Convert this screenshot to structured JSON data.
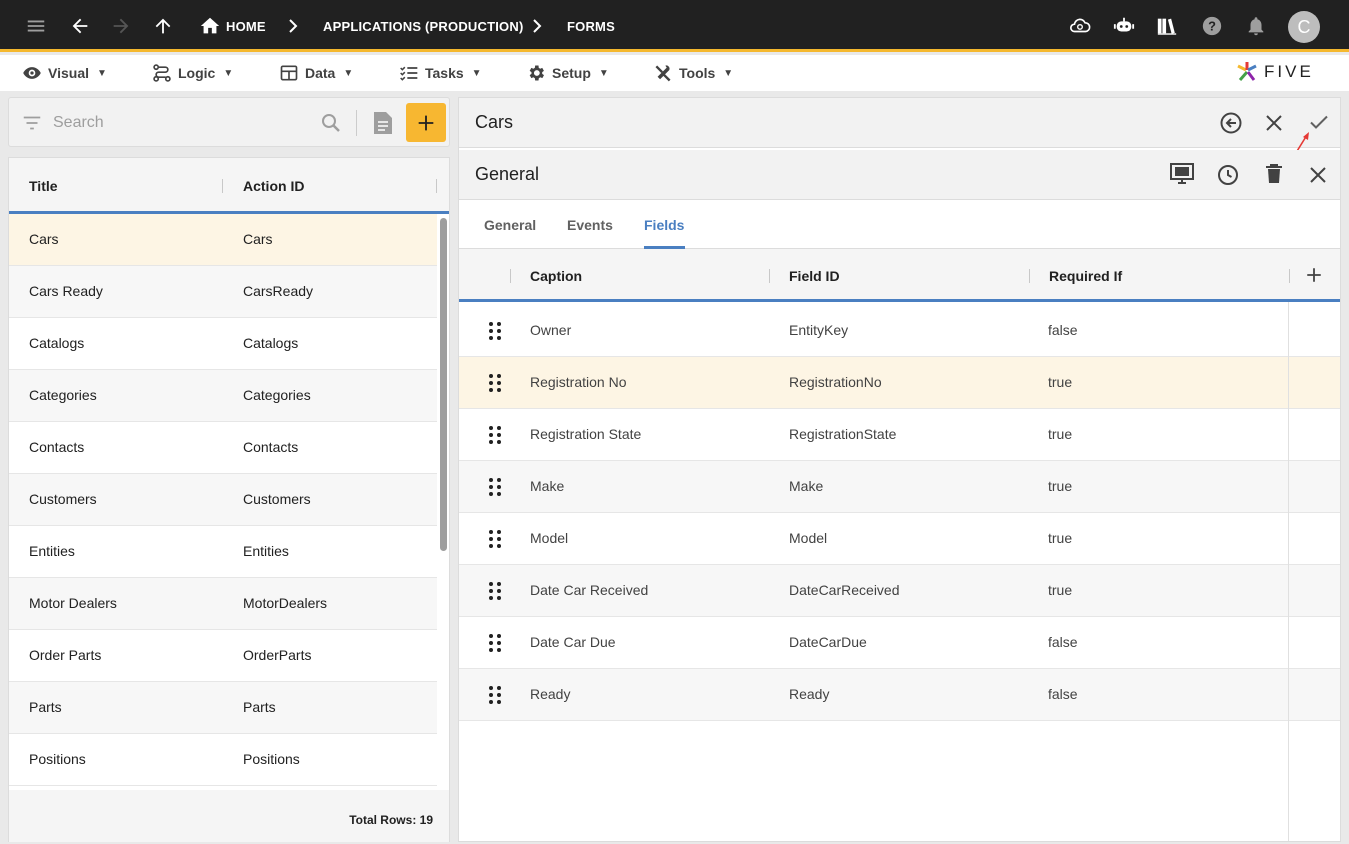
{
  "breadcrumbs": [
    "HOME",
    "APPLICATIONS (PRODUCTION)",
    "FORMS"
  ],
  "user_initial": "C",
  "menu": [
    {
      "label": "Visual",
      "icon": "eye-icon"
    },
    {
      "label": "Logic",
      "icon": "logic-icon"
    },
    {
      "label": "Data",
      "icon": "table-icon"
    },
    {
      "label": "Tasks",
      "icon": "tasks-icon"
    },
    {
      "label": "Setup",
      "icon": "gear-icon"
    },
    {
      "label": "Tools",
      "icon": "tools-icon"
    }
  ],
  "logo_text": "FIVE",
  "search": {
    "placeholder": "Search"
  },
  "left_table": {
    "columns": [
      "Title",
      "Action ID"
    ],
    "rows": [
      [
        "Cars",
        "Cars"
      ],
      [
        "Cars Ready",
        "CarsReady"
      ],
      [
        "Catalogs",
        "Catalogs"
      ],
      [
        "Categories",
        "Categories"
      ],
      [
        "Contacts",
        "Contacts"
      ],
      [
        "Customers",
        "Customers"
      ],
      [
        "Entities",
        "Entities"
      ],
      [
        "Motor Dealers",
        "MotorDealers"
      ],
      [
        "Order Parts",
        "OrderParts"
      ],
      [
        "Parts",
        "Parts"
      ],
      [
        "Positions",
        "Positions"
      ]
    ],
    "total_rows": "Total Rows: 19"
  },
  "form": {
    "title": "Cars",
    "section_title": "General",
    "tabs": [
      "General",
      "Events",
      "Fields"
    ],
    "active_tab": "Fields",
    "fields_columns": [
      "Caption",
      "Field ID",
      "Required If"
    ],
    "fields_rows": [
      [
        "Owner",
        "EntityKey",
        "false"
      ],
      [
        "Registration No",
        "RegistrationNo",
        "true"
      ],
      [
        "Registration State",
        "RegistrationState",
        "true"
      ],
      [
        "Make",
        "Make",
        "true"
      ],
      [
        "Model",
        "Model",
        "true"
      ],
      [
        "Date Car Received",
        "DateCarReceived",
        "true"
      ],
      [
        "Date Car Due",
        "DateCarDue",
        "false"
      ],
      [
        "Ready",
        "Ready",
        "false"
      ]
    ]
  },
  "colors": {
    "accent": "#f5b82e",
    "tab_active": "#4a7fc1",
    "selected_row": "#fdf5e4",
    "annotation_arrow": "#e53935"
  }
}
